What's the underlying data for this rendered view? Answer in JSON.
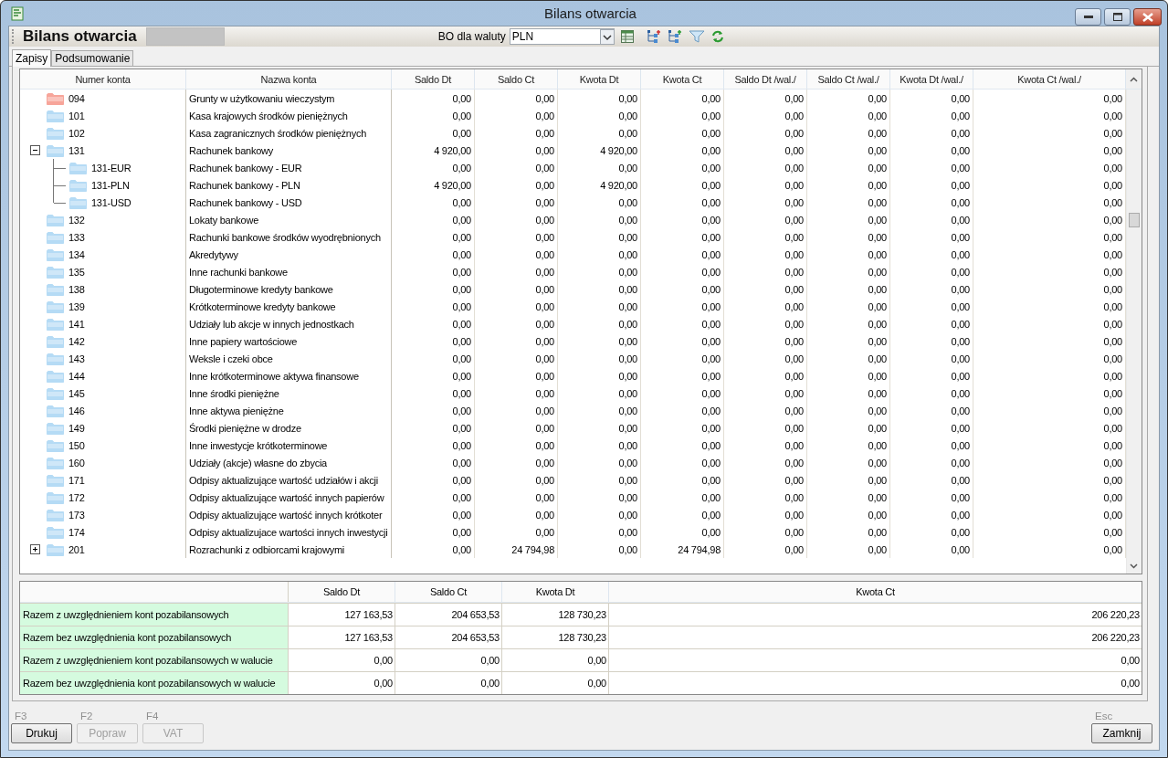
{
  "window": {
    "title": "Bilans otwarcia"
  },
  "toolbar": {
    "title": "Bilans otwarcia",
    "currency_label": "BO dla waluty",
    "currency": "PLN"
  },
  "tabs": [
    {
      "label": "Zapisy",
      "selected": true
    },
    {
      "label": "Podsumowanie",
      "selected": false
    }
  ],
  "table": {
    "columns": [
      "Numer konta",
      "Nazwa konta",
      "Saldo Dt",
      "Saldo Ct",
      "Kwota Dt",
      "Kwota Ct",
      "Saldo Dt /wal./",
      "Saldo Ct /wal./",
      "Kwota Dt /wal./",
      "Kwota Ct /wal./"
    ],
    "rows": [
      {
        "number": "094",
        "name": "Grunty w użytkowaniu wieczystym",
        "color": "#f7a59a",
        "values": [
          "0,00",
          "0,00",
          "0,00",
          "0,00",
          "0,00",
          "0,00",
          "0,00",
          "0,00"
        ]
      },
      {
        "number": "101",
        "name": "Kasa krajowych środków pieniężnych",
        "color": "#b5dbf5",
        "values": [
          "0,00",
          "0,00",
          "0,00",
          "0,00",
          "0,00",
          "0,00",
          "0,00",
          "0,00"
        ]
      },
      {
        "number": "102",
        "name": "Kasa zagranicznych środków pieniężnych",
        "color": "#b5dbf5",
        "values": [
          "0,00",
          "0,00",
          "0,00",
          "0,00",
          "0,00",
          "0,00",
          "0,00",
          "0,00"
        ]
      },
      {
        "number": "131",
        "name": "Rachunek bankowy",
        "color": "#b5dbf5",
        "expanded": true,
        "values": [
          "4 920,00",
          "0,00",
          "4 920,00",
          "0,00",
          "0,00",
          "0,00",
          "0,00",
          "0,00"
        ],
        "children": [
          {
            "number": "131-EUR",
            "name": "Rachunek bankowy - EUR",
            "color": "#b5dbf5",
            "values": [
              "0,00",
              "0,00",
              "0,00",
              "0,00",
              "0,00",
              "0,00",
              "0,00",
              "0,00"
            ]
          },
          {
            "number": "131-PLN",
            "name": "Rachunek bankowy - PLN",
            "color": "#b5dbf5",
            "values": [
              "4 920,00",
              "0,00",
              "4 920,00",
              "0,00",
              "0,00",
              "0,00",
              "0,00",
              "0,00"
            ]
          },
          {
            "number": "131-USD",
            "name": "Rachunek bankowy - USD",
            "color": "#b5dbf5",
            "values": [
              "0,00",
              "0,00",
              "0,00",
              "0,00",
              "0,00",
              "0,00",
              "0,00",
              "0,00"
            ]
          }
        ]
      },
      {
        "number": "132",
        "name": "Lokaty bankowe",
        "color": "#b5dbf5",
        "values": [
          "0,00",
          "0,00",
          "0,00",
          "0,00",
          "0,00",
          "0,00",
          "0,00",
          "0,00"
        ]
      },
      {
        "number": "133",
        "name": "Rachunki bankowe środków wyodrębnionych",
        "color": "#b5dbf5",
        "values": [
          "0,00",
          "0,00",
          "0,00",
          "0,00",
          "0,00",
          "0,00",
          "0,00",
          "0,00"
        ]
      },
      {
        "number": "134",
        "name": "Akredytywy",
        "color": "#b5dbf5",
        "values": [
          "0,00",
          "0,00",
          "0,00",
          "0,00",
          "0,00",
          "0,00",
          "0,00",
          "0,00"
        ]
      },
      {
        "number": "135",
        "name": "Inne rachunki bankowe",
        "color": "#b5dbf5",
        "values": [
          "0,00",
          "0,00",
          "0,00",
          "0,00",
          "0,00",
          "0,00",
          "0,00",
          "0,00"
        ]
      },
      {
        "number": "138",
        "name": "Długoterminowe kredyty bankowe",
        "color": "#b5dbf5",
        "values": [
          "0,00",
          "0,00",
          "0,00",
          "0,00",
          "0,00",
          "0,00",
          "0,00",
          "0,00"
        ]
      },
      {
        "number": "139",
        "name": "Krótkoterminowe kredyty bankowe",
        "color": "#b5dbf5",
        "values": [
          "0,00",
          "0,00",
          "0,00",
          "0,00",
          "0,00",
          "0,00",
          "0,00",
          "0,00"
        ]
      },
      {
        "number": "141",
        "name": "Udziały lub akcje w innych jednostkach",
        "color": "#b5dbf5",
        "values": [
          "0,00",
          "0,00",
          "0,00",
          "0,00",
          "0,00",
          "0,00",
          "0,00",
          "0,00"
        ]
      },
      {
        "number": "142",
        "name": "Inne papiery wartościowe",
        "color": "#b5dbf5",
        "values": [
          "0,00",
          "0,00",
          "0,00",
          "0,00",
          "0,00",
          "0,00",
          "0,00",
          "0,00"
        ]
      },
      {
        "number": "143",
        "name": "Weksle i czeki obce",
        "color": "#b5dbf5",
        "values": [
          "0,00",
          "0,00",
          "0,00",
          "0,00",
          "0,00",
          "0,00",
          "0,00",
          "0,00"
        ]
      },
      {
        "number": "144",
        "name": "Inne krótkoterminowe aktywa finansowe",
        "color": "#b5dbf5",
        "values": [
          "0,00",
          "0,00",
          "0,00",
          "0,00",
          "0,00",
          "0,00",
          "0,00",
          "0,00"
        ]
      },
      {
        "number": "145",
        "name": "Inne środki pieniężne",
        "color": "#b5dbf5",
        "values": [
          "0,00",
          "0,00",
          "0,00",
          "0,00",
          "0,00",
          "0,00",
          "0,00",
          "0,00"
        ]
      },
      {
        "number": "146",
        "name": "Inne aktywa pieniężne",
        "color": "#b5dbf5",
        "values": [
          "0,00",
          "0,00",
          "0,00",
          "0,00",
          "0,00",
          "0,00",
          "0,00",
          "0,00"
        ]
      },
      {
        "number": "149",
        "name": "Środki pieniężne w drodze",
        "color": "#b5dbf5",
        "values": [
          "0,00",
          "0,00",
          "0,00",
          "0,00",
          "0,00",
          "0,00",
          "0,00",
          "0,00"
        ]
      },
      {
        "number": "150",
        "name": "Inne inwestycje krótkoterminowe",
        "color": "#b5dbf5",
        "values": [
          "0,00",
          "0,00",
          "0,00",
          "0,00",
          "0,00",
          "0,00",
          "0,00",
          "0,00"
        ]
      },
      {
        "number": "160",
        "name": "Udziały (akcje) własne do zbycia",
        "color": "#b5dbf5",
        "values": [
          "0,00",
          "0,00",
          "0,00",
          "0,00",
          "0,00",
          "0,00",
          "0,00",
          "0,00"
        ]
      },
      {
        "number": "171",
        "name": "Odpisy aktualizujące wartość udziałów i akcji",
        "color": "#b5dbf5",
        "values": [
          "0,00",
          "0,00",
          "0,00",
          "0,00",
          "0,00",
          "0,00",
          "0,00",
          "0,00"
        ]
      },
      {
        "number": "172",
        "name": "Odpisy aktualizujące wartość innych papierów",
        "color": "#b5dbf5",
        "values": [
          "0,00",
          "0,00",
          "0,00",
          "0,00",
          "0,00",
          "0,00",
          "0,00",
          "0,00"
        ]
      },
      {
        "number": "173",
        "name": "Odpisy aktualizujące wartość innych krótkoter",
        "color": "#b5dbf5",
        "values": [
          "0,00",
          "0,00",
          "0,00",
          "0,00",
          "0,00",
          "0,00",
          "0,00",
          "0,00"
        ]
      },
      {
        "number": "174",
        "name": "Odpisy aktualizujace wartości innych inwestycji",
        "color": "#b5dbf5",
        "values": [
          "0,00",
          "0,00",
          "0,00",
          "0,00",
          "0,00",
          "0,00",
          "0,00",
          "0,00"
        ]
      },
      {
        "number": "201",
        "name": "Rozrachunki z odbiorcami krajowymi",
        "color": "#b5dbf5",
        "expanded": false,
        "values": [
          "0,00",
          "24 794,98",
          "0,00",
          "24 794,98",
          "0,00",
          "0,00",
          "0,00",
          "0,00"
        ]
      }
    ]
  },
  "summary": {
    "columns": [
      "Saldo Dt",
      "Saldo Ct",
      "Kwota Dt",
      "Kwota Ct"
    ],
    "rows": [
      {
        "label": "Razem z uwzględnieniem kont pozabilansowych",
        "values": [
          "127 163,53",
          "204 653,53",
          "128 730,23",
          "206 220,23"
        ]
      },
      {
        "label": "Razem bez uwzględnienia kont pozabilansowych",
        "values": [
          "127 163,53",
          "204 653,53",
          "128 730,23",
          "206 220,23"
        ]
      },
      {
        "label": "Razem z uwzględnieniem kont pozabilansowych w walucie",
        "values": [
          "0,00",
          "0,00",
          "0,00",
          "0,00"
        ]
      },
      {
        "label": "Razem bez uwzględnienia kont pozabilansowych w walucie",
        "values": [
          "0,00",
          "0,00",
          "0,00",
          "0,00"
        ]
      }
    ]
  },
  "buttons_left": [
    {
      "hotkey": "F3",
      "label": "Drukuj",
      "disabled": false
    },
    {
      "hotkey": "F2",
      "label": "Popraw",
      "disabled": true
    },
    {
      "hotkey": "F4",
      "label": "VAT",
      "disabled": true
    }
  ],
  "buttons_right": [
    {
      "hotkey": "Esc",
      "label": "Zamknij",
      "disabled": false
    }
  ]
}
